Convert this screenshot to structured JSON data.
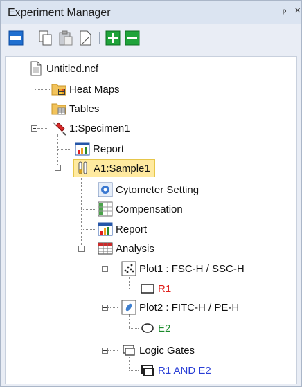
{
  "window": {
    "title": "Experiment Manager",
    "pin_glyph": "ᵖ",
    "close_glyph": "×"
  },
  "toolbar": {
    "buttons": [
      {
        "name": "view-toggle-icon"
      },
      {
        "name": "copy-icon"
      },
      {
        "name": "paste-icon"
      },
      {
        "name": "document-icon"
      },
      {
        "name": "add-icon"
      },
      {
        "name": "remove-icon"
      }
    ]
  },
  "tree": {
    "file": "Untitled.ncf",
    "heat_maps": "Heat Maps",
    "tables": "Tables",
    "specimen": "1:Specimen1",
    "specimen_report": "Report",
    "sample": "A1:Sample1",
    "cytometer_setting": "Cytometer Setting",
    "compensation": "Compensation",
    "sample_report": "Report",
    "analysis": "Analysis",
    "plot1": "Plot1 : FSC-H / SSC-H",
    "gate_r1": "R1",
    "plot2": "Plot2 : FITC-H / PE-H",
    "gate_e2": "E2",
    "logic_gates": "Logic Gates",
    "logic_gate_item": "R1 AND E2"
  },
  "colors": {
    "gate_r1": "#e0201b",
    "gate_e2": "#1a8a2a",
    "logic_gate_item": "#2a3fd6",
    "selected_bg": "#ffeaa0"
  }
}
